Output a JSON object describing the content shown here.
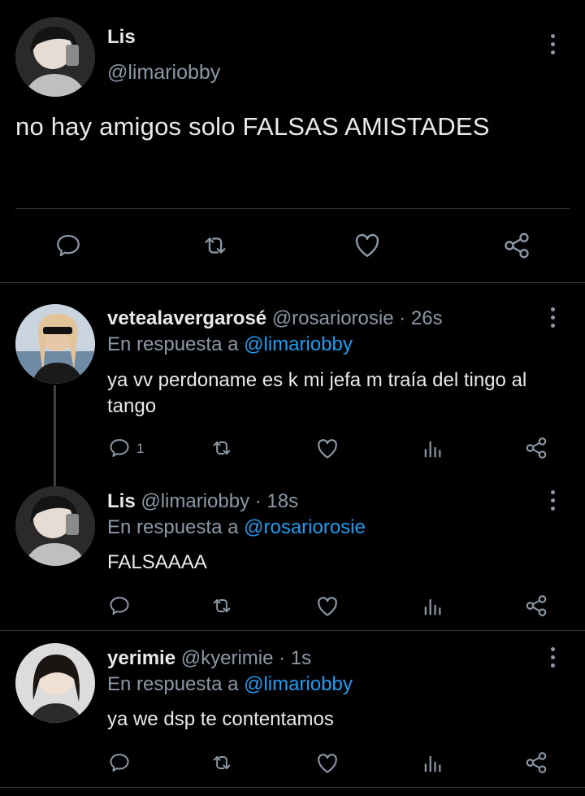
{
  "main_tweet": {
    "name": "Lis",
    "handle": "@limariobby",
    "text": "no hay amigos solo FALSAS AMISTADES"
  },
  "main_actions": [
    "reply-icon",
    "retweet-icon",
    "like-icon",
    "share-icon"
  ],
  "replies": [
    {
      "name": "vetealavergarosé",
      "handle": "@rosariorosie",
      "time": "· 26s",
      "reply_prefix": "En respuesta a",
      "reply_to": "@limariobby",
      "text": "ya vv perdoname es k mi jefa m traía del tingo al tango",
      "reply_count": "1"
    },
    {
      "name": "Lis",
      "handle": "@limariobby",
      "time": "· 18s",
      "reply_prefix": "En respuesta a",
      "reply_to": "@rosariorosie",
      "text": "FALSAAAA",
      "reply_count": ""
    },
    {
      "name": "yerimie",
      "handle": "@kyerimie",
      "time": "· 1s",
      "reply_prefix": "En respuesta a",
      "reply_to": "@limariobby",
      "text": "ya we dsp te contentamos",
      "reply_count": ""
    }
  ],
  "colors": {
    "background": "#000000",
    "text": "#e7e9ea",
    "muted": "#8b98a5",
    "link": "#1d9bf0",
    "divider": "#2f3336"
  }
}
